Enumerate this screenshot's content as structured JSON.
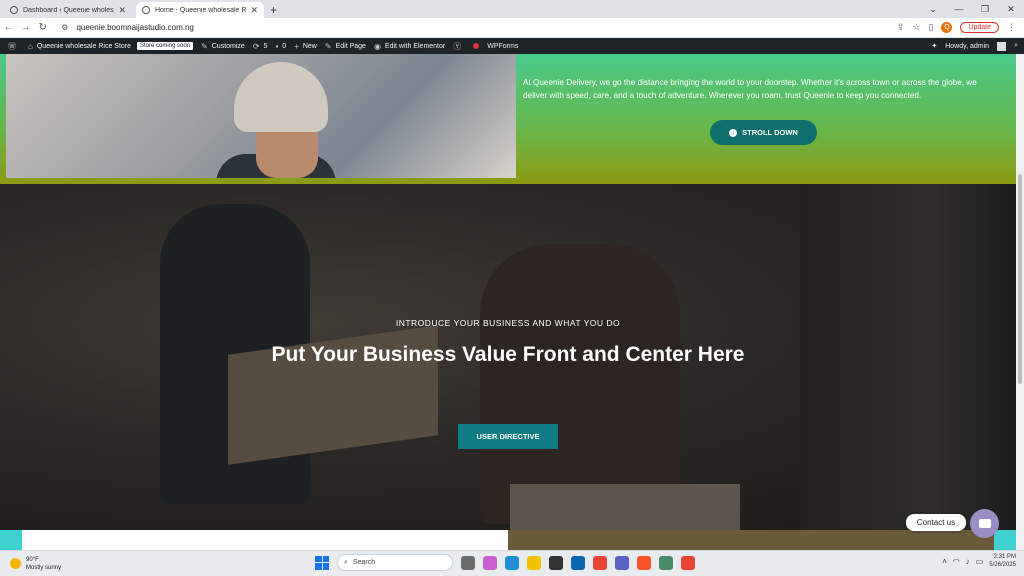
{
  "browser": {
    "tabs": [
      {
        "label": "Dashboard ‹ Queenie wholesale"
      },
      {
        "label": "Home - Queenie wholesale Rice"
      }
    ],
    "url": "queenie.boomnaijastudio.com.ng",
    "profile_initial": "Q",
    "update_label": "Update"
  },
  "adminbar": {
    "site_name": "Queenie wholesale Rice Store",
    "badge": "Store coming soon",
    "customize": "Customize",
    "updates_count": "5",
    "comments_count": "0",
    "new": "New",
    "edit_page": "Edit Page",
    "edit_elementor": "Edit with Elementor",
    "wpforms": "WPForms",
    "howdy": "Howdy, admin"
  },
  "top_section": {
    "description": "At Queenie Delivery, we go the distance bringing the world to your doorstep. Whether it's across town or across the globe, we deliver with speed, care, and a touch of adventure. Wherever you roam, trust Queenie to keep you connected.",
    "button_label": "STROLL DOWN"
  },
  "hero": {
    "kicker": "INTRODUCE YOUR BUSINESS AND WHAT YOU DO",
    "title": "Put Your Business Value Front and Center Here",
    "button_label": "USER DIRECTIVE"
  },
  "contact": {
    "label": "Contact us"
  },
  "taskbar": {
    "temperature": "90°F",
    "condition": "Mostly sunny",
    "search_placeholder": "Search",
    "time": "2:31 PM",
    "date": "5/26/2025"
  },
  "colors": {
    "accent_teal": "#0f6f6c",
    "admin_bar": "#1d2327"
  }
}
